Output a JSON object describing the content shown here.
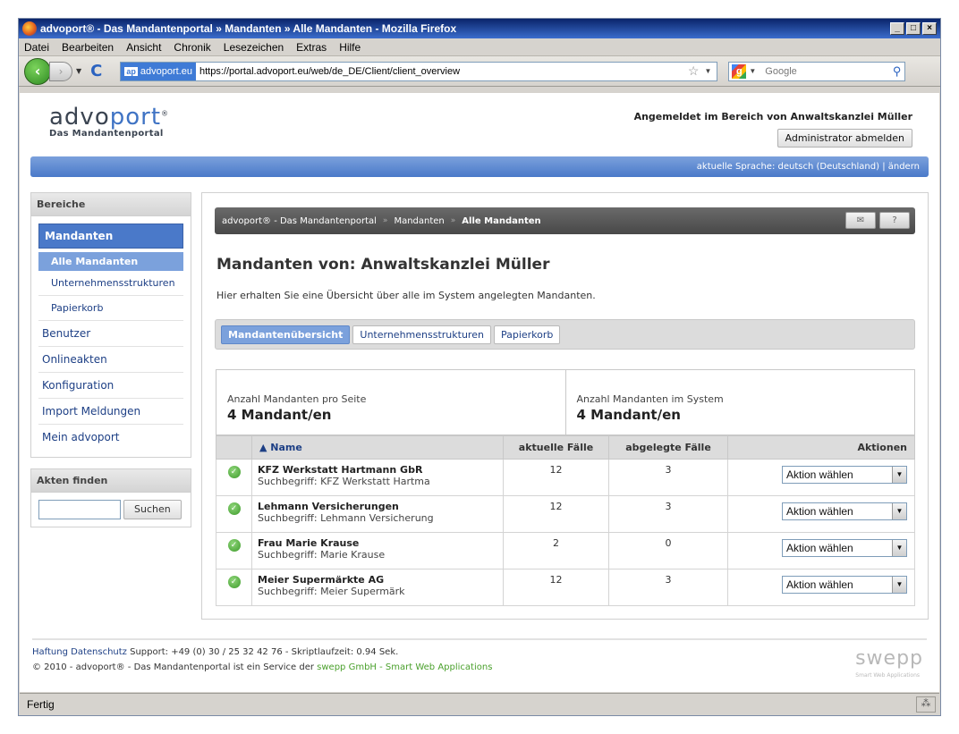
{
  "browser": {
    "title": "advoport® - Das Mandantenportal » Mandanten » Alle Mandanten - Mozilla Firefox",
    "menu": [
      "Datei",
      "Bearbeiten",
      "Ansicht",
      "Chronik",
      "Lesezeichen",
      "Extras",
      "Hilfe"
    ],
    "site_badge_icon": "ap",
    "site_badge": "advoport.eu",
    "url": "https://portal.advoport.eu/web/de_DE/Client/client_overview",
    "search_placeholder": "Google",
    "status": "Fertig"
  },
  "header": {
    "logo_prefix": "advo",
    "logo_suffix": "port",
    "logo_mark": "®",
    "logo_sub": "Das Mandantenportal",
    "logged_in": "Angemeldet im Bereich von Anwaltskanzlei Müller",
    "logout": "Administrator abmelden",
    "language": "aktuelle Sprache: deutsch (Deutschland) | ändern"
  },
  "sidebar": {
    "areas_title": "Bereiche",
    "section": "Mandanten",
    "sub_active": "Alle Mandanten",
    "subs": [
      "Unternehmensstrukturen",
      "Papierkorb"
    ],
    "items": [
      "Benutzer",
      "Onlineakten",
      "Konfiguration",
      "Import Meldungen",
      "Mein advoport"
    ],
    "find_title": "Akten finden",
    "find_value": "",
    "find_button": "Suchen"
  },
  "breadcrumb": [
    "advoport® - Das Mandantenportal",
    "Mandanten",
    "Alle Mandanten"
  ],
  "main": {
    "title": "Mandanten von: Anwaltskanzlei Müller",
    "intro": "Hier erhalten Sie eine Übersicht über alle im System angelegten Mandanten.",
    "tabs": [
      "Mandantenübersicht",
      "Unternehmensstrukturen",
      "Papierkorb"
    ],
    "active_tab": 0,
    "stat_page_label": "Anzahl Mandanten pro Seite",
    "stat_page_value": "4 Mandant/en",
    "stat_system_label": "Anzahl Mandanten im System",
    "stat_system_value": "4 Mandant/en"
  },
  "table": {
    "headers": {
      "name": "▲ Name",
      "current": "aktuelle Fälle",
      "archived": "abgelegte Fälle",
      "actions": "Aktionen"
    },
    "rows": [
      {
        "name": "KFZ Werkstatt Hartmann GbR",
        "search": "Suchbegriff: KFZ Werkstatt Hartma",
        "current": "12",
        "archived": "3",
        "action": "Aktion wählen"
      },
      {
        "name": "Lehmann Versicherungen",
        "search": "Suchbegriff: Lehmann Versicherung",
        "current": "12",
        "archived": "3",
        "action": "Aktion wählen"
      },
      {
        "name": "Frau Marie Krause",
        "search": "Suchbegriff: Marie Krause",
        "current": "2",
        "archived": "0",
        "action": "Aktion wählen"
      },
      {
        "name": "Meier Supermärkte AG",
        "search": "Suchbegriff: Meier Supermärk",
        "current": "12",
        "archived": "3",
        "action": "Aktion wählen"
      }
    ]
  },
  "footer": {
    "haftung": "Haftung",
    "datenschutz": "Datenschutz",
    "support": "Support: +49 (0) 30 / 25 32 42 76 - Skriptlaufzeit: 0.94 Sek.",
    "copyright": "© 2010 - advoport® - Das Mandantenportal ist ein Service der",
    "partner": "swepp GmbH - Smart Web Applications",
    "brand": "swepp",
    "brand_sub": "Smart Web Applications"
  }
}
